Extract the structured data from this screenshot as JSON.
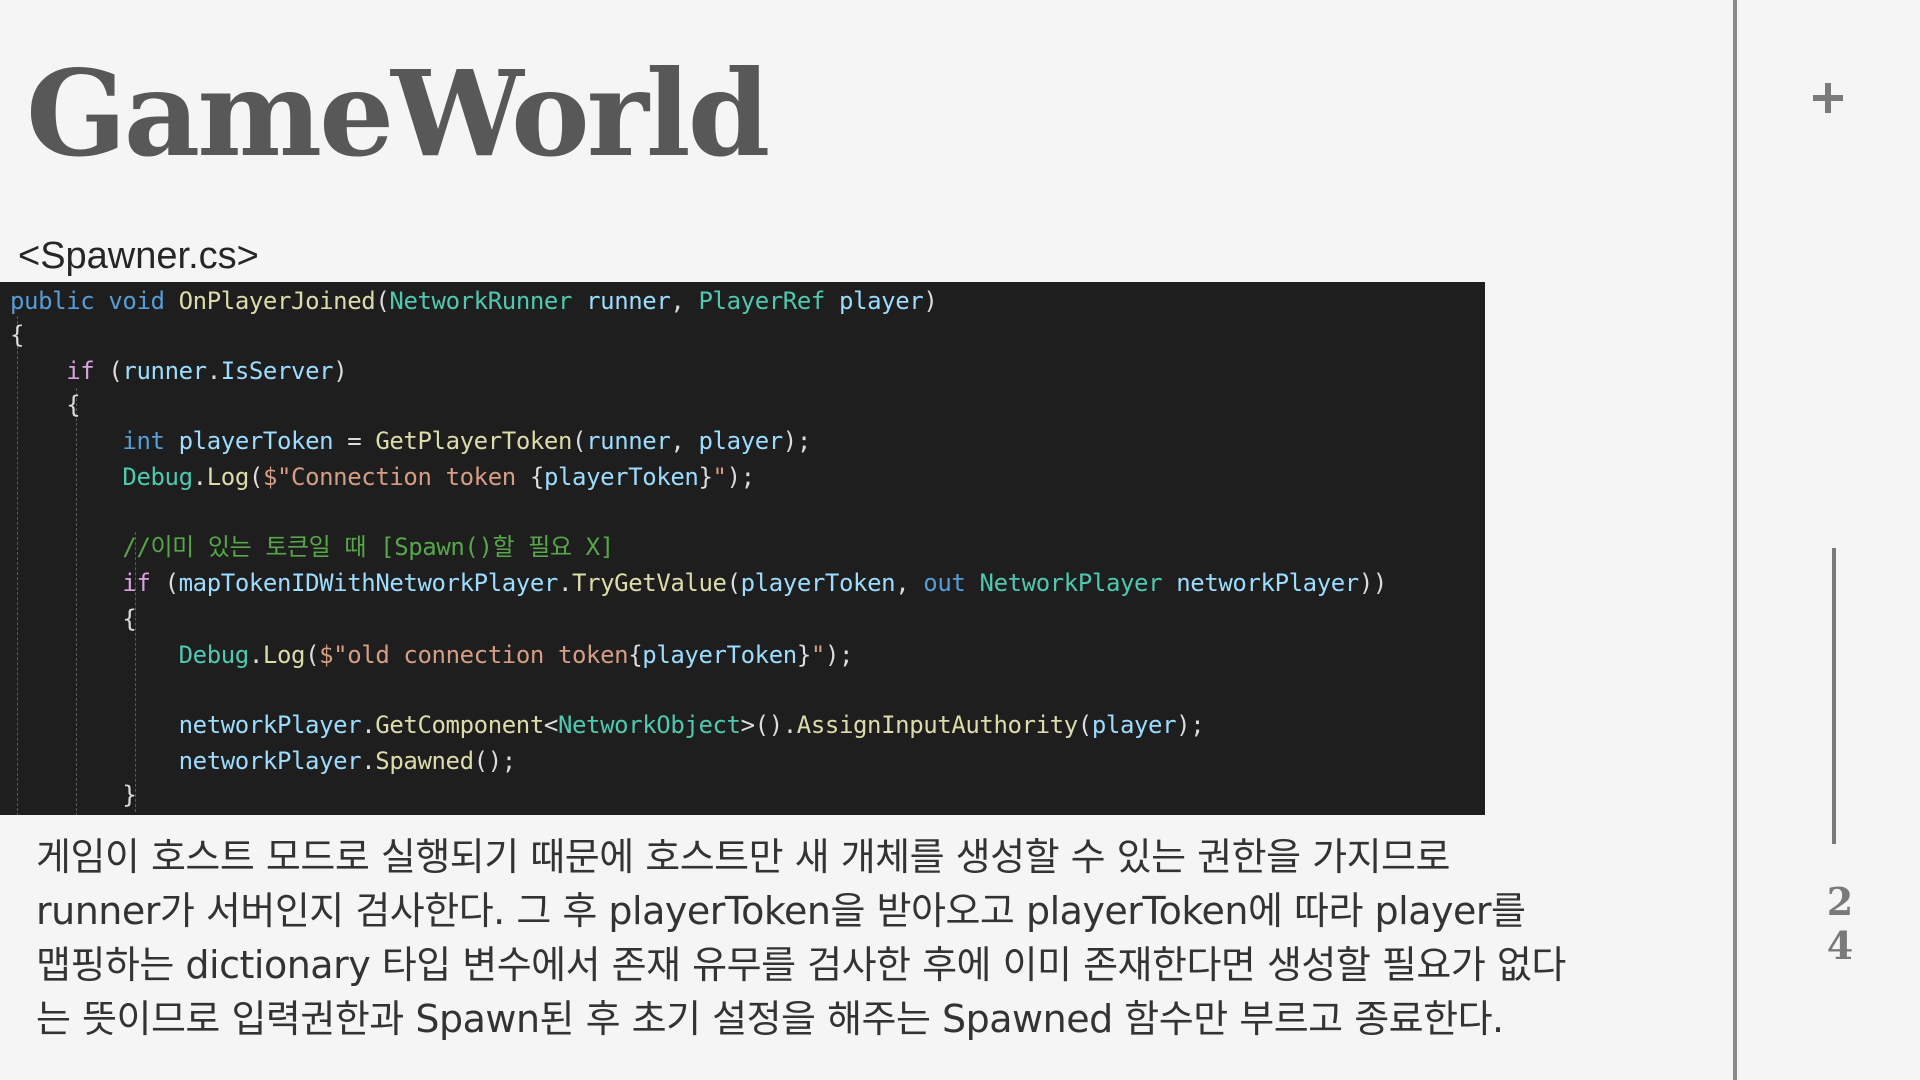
{
  "slide": {
    "title": "GameWorld",
    "file_label": "<Spawner.cs>",
    "page_number_digits": [
      "2",
      "4"
    ]
  },
  "code": {
    "lines": [
      [
        [
          "kw",
          "public"
        ],
        [
          "punc",
          " "
        ],
        [
          "kw",
          "void"
        ],
        [
          "punc",
          " "
        ],
        [
          "fn",
          "OnPlayerJoined"
        ],
        [
          "punc",
          "("
        ],
        [
          "type",
          "NetworkRunner"
        ],
        [
          "punc",
          " "
        ],
        [
          "var",
          "runner"
        ],
        [
          "punc",
          ", "
        ],
        [
          "type",
          "PlayerRef"
        ],
        [
          "punc",
          " "
        ],
        [
          "var",
          "player"
        ],
        [
          "punc",
          ")"
        ]
      ],
      [
        [
          "punc",
          "{"
        ]
      ],
      [
        [
          "punc",
          "    "
        ],
        [
          "ctl",
          "if"
        ],
        [
          "punc",
          " ("
        ],
        [
          "var",
          "runner"
        ],
        [
          "punc",
          "."
        ],
        [
          "var",
          "IsServer"
        ],
        [
          "punc",
          ")"
        ]
      ],
      [
        [
          "punc",
          "    {"
        ]
      ],
      [
        [
          "punc",
          "        "
        ],
        [
          "kw",
          "int"
        ],
        [
          "punc",
          " "
        ],
        [
          "var",
          "playerToken"
        ],
        [
          "punc",
          " = "
        ],
        [
          "fn",
          "GetPlayerToken"
        ],
        [
          "punc",
          "("
        ],
        [
          "var",
          "runner"
        ],
        [
          "punc",
          ", "
        ],
        [
          "var",
          "player"
        ],
        [
          "punc",
          ");"
        ]
      ],
      [
        [
          "punc",
          "        "
        ],
        [
          "type",
          "Debug"
        ],
        [
          "punc",
          "."
        ],
        [
          "fn",
          "Log"
        ],
        [
          "punc",
          "("
        ],
        [
          "str",
          "$\"Connection token "
        ],
        [
          "punc",
          "{"
        ],
        [
          "var",
          "playerToken"
        ],
        [
          "punc",
          "}"
        ],
        [
          "str",
          "\""
        ],
        [
          "punc",
          ");"
        ]
      ],
      [],
      [
        [
          "punc",
          "        "
        ],
        [
          "cmt",
          "//이미 있는 토큰일 때 [Spawn()할 필요 X]"
        ]
      ],
      [
        [
          "punc",
          "        "
        ],
        [
          "ctl",
          "if"
        ],
        [
          "punc",
          " ("
        ],
        [
          "var",
          "mapTokenIDWithNetworkPlayer"
        ],
        [
          "punc",
          "."
        ],
        [
          "fn",
          "TryGetValue"
        ],
        [
          "punc",
          "("
        ],
        [
          "var",
          "playerToken"
        ],
        [
          "punc",
          ", "
        ],
        [
          "kw",
          "out"
        ],
        [
          "punc",
          " "
        ],
        [
          "type",
          "NetworkPlayer"
        ],
        [
          "punc",
          " "
        ],
        [
          "var",
          "networkPlayer"
        ],
        [
          "punc",
          "))"
        ]
      ],
      [
        [
          "punc",
          "        {"
        ]
      ],
      [
        [
          "punc",
          "            "
        ],
        [
          "type",
          "Debug"
        ],
        [
          "punc",
          "."
        ],
        [
          "fn",
          "Log"
        ],
        [
          "punc",
          "("
        ],
        [
          "str",
          "$\"old connection token"
        ],
        [
          "punc",
          "{"
        ],
        [
          "var",
          "playerToken"
        ],
        [
          "punc",
          "}"
        ],
        [
          "str",
          "\""
        ],
        [
          "punc",
          ");"
        ]
      ],
      [],
      [
        [
          "punc",
          "            "
        ],
        [
          "var",
          "networkPlayer"
        ],
        [
          "punc",
          "."
        ],
        [
          "fn",
          "GetComponent"
        ],
        [
          "punc",
          "<"
        ],
        [
          "type",
          "NetworkObject"
        ],
        [
          "punc",
          ">()."
        ],
        [
          "fn",
          "AssignInputAuthority"
        ],
        [
          "punc",
          "("
        ],
        [
          "var",
          "player"
        ],
        [
          "punc",
          ");"
        ]
      ],
      [
        [
          "punc",
          "            "
        ],
        [
          "var",
          "networkPlayer"
        ],
        [
          "punc",
          "."
        ],
        [
          "fn",
          "Spawned"
        ],
        [
          "punc",
          "();"
        ]
      ],
      [
        [
          "punc",
          "        }"
        ]
      ]
    ],
    "colors": {
      "background": "#1e1e1e",
      "keyword": "#569cd6",
      "control": "#d8a0df",
      "type": "#4ec9b0",
      "variable": "#9cdcfe",
      "function": "#dcdcaa",
      "string": "#d69d85",
      "comment": "#57a64a",
      "punctuation": "#dcdcdc"
    }
  },
  "description": {
    "lines": [
      "게임이 호스트 모드로 실행되기 때문에 호스트만 새 개체를 생성할 수 있는 권한을 가지므로",
      "runner가 서버인지 검사한다. 그 후 playerToken을 받아오고 playerToken에 따라 player를",
      "맵핑하는 dictionary 타입 변수에서 존재 유무를 검사한 후에 이미 존재한다면 생성할 필요가 없다",
      "는 뜻이므로 입력권한과 Spawn된 후 초기 설정을 해주는 Spawned 함수만 부르고 종료한다."
    ]
  },
  "icons": {
    "plus": "plus-icon"
  }
}
